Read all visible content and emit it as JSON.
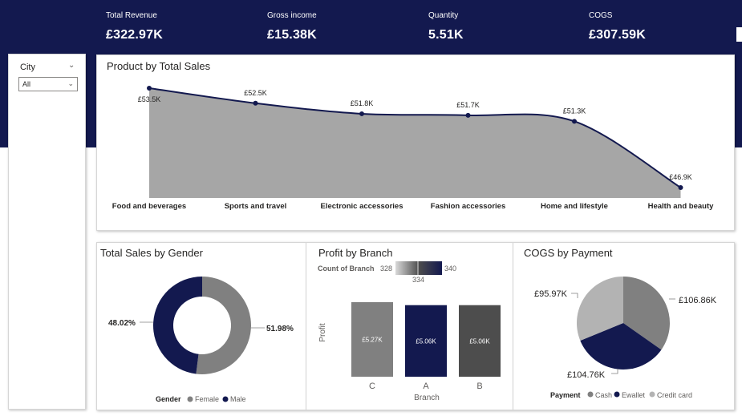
{
  "kpis": [
    {
      "label": "Total Revenue",
      "value": "£322.97K"
    },
    {
      "label": "Gross income",
      "value": "£15.38K"
    },
    {
      "label": "Quantity",
      "value": "5.51K"
    },
    {
      "label": "COGS",
      "value": "£307.59K"
    }
  ],
  "slicer": {
    "label": "City",
    "selected": "All"
  },
  "colors": {
    "navy": "#13194f",
    "gray": "#808080",
    "dark_gray": "#4d4d4d",
    "light_gray": "#b3b3b3",
    "area_fill": "#a6a6a6"
  },
  "chart_data": [
    {
      "type": "area",
      "title": "Product by Total Sales",
      "categories": [
        "Food and beverages",
        "Sports and travel",
        "Electronic accessories",
        "Fashion accessories",
        "Home and lifestyle",
        "Health and beauty"
      ],
      "values": [
        53.5,
        52.5,
        51.8,
        51.7,
        51.3,
        46.9
      ],
      "data_labels": [
        "£53.5K",
        "£52.5K",
        "£51.8K",
        "£51.7K",
        "£51.3K",
        "£46.9K"
      ],
      "unit": "K £"
    },
    {
      "type": "pie",
      "subtype": "donut",
      "title": "Total Sales by Gender",
      "legend_title": "Gender",
      "categories": [
        "Female",
        "Male"
      ],
      "values": [
        51.98,
        48.02
      ],
      "data_labels": [
        "51.98%",
        "48.02%"
      ],
      "colors": [
        "#808080",
        "#13194f"
      ],
      "legend": "bottom"
    },
    {
      "type": "bar",
      "title": "Profit by Branch",
      "xlabel": "Branch",
      "ylabel": "Profit",
      "categories": [
        "C",
        "A",
        "B"
      ],
      "values": [
        5.27,
        5.06,
        5.06
      ],
      "data_labels": [
        "£5.27K",
        "£5.06K",
        "£5.06K"
      ],
      "color_scale": {
        "label": "Count of Branch",
        "min": "328",
        "mid": "334",
        "max": "340"
      },
      "colors": [
        "#808080",
        "#13194f",
        "#4d4d4d"
      ]
    },
    {
      "type": "pie",
      "title": "COGS by Payment",
      "legend_title": "Payment",
      "categories": [
        "Cash",
        "Ewallet",
        "Credit card"
      ],
      "values": [
        106.86,
        104.76,
        95.97
      ],
      "data_labels": [
        "£106.86K",
        "£104.76K",
        "£95.97K"
      ],
      "colors": [
        "#808080",
        "#13194f",
        "#b3b3b3"
      ],
      "legend": "bottom"
    }
  ]
}
